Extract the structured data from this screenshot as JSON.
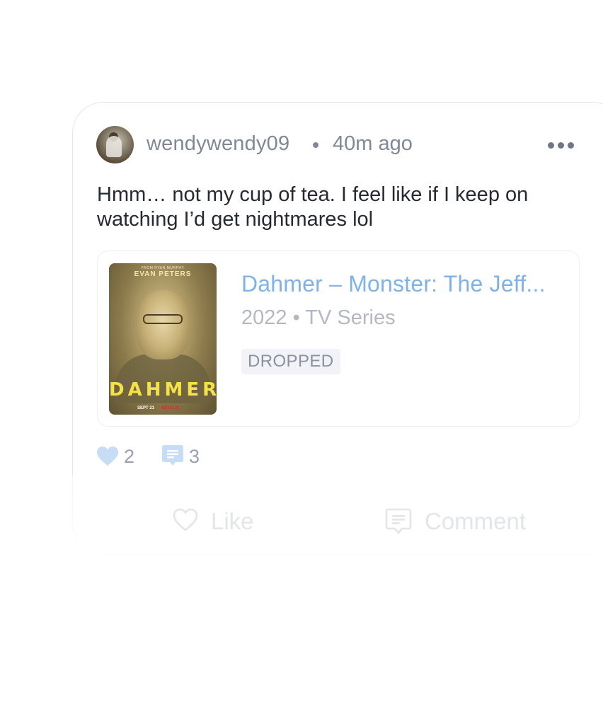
{
  "post": {
    "username": "wendywendy09",
    "separator": "•",
    "time_ago": "40m ago",
    "more_icon": "more-horizontal-icon",
    "text": "Hmm… not my cup of tea. I feel like if I keep on watching I’d get nightmares lol"
  },
  "media": {
    "title": "Dahmer – Monster: The Jeff...",
    "meta": "2022 • TV Series",
    "status": "DROPPED",
    "poster": {
      "top_credit": "FROM RYAN MURPHY",
      "actor": "EVAN PETERS",
      "title": "DAHMER",
      "date": "SEPT 21",
      "brand": "NETFLIX"
    }
  },
  "stats": {
    "likes": "2",
    "comments": "3",
    "heart_icon": "heart-filled-icon",
    "comment_icon": "comment-filled-icon"
  },
  "actions": {
    "like_label": "Like",
    "comment_label": "Comment",
    "like_icon": "heart-outline-icon",
    "comment_icon": "comment-outline-icon"
  },
  "colors": {
    "accent": "#7fb3e8",
    "icon_fill": "#c6ddf5",
    "text_primary": "#262b33",
    "text_secondary": "#808896"
  }
}
